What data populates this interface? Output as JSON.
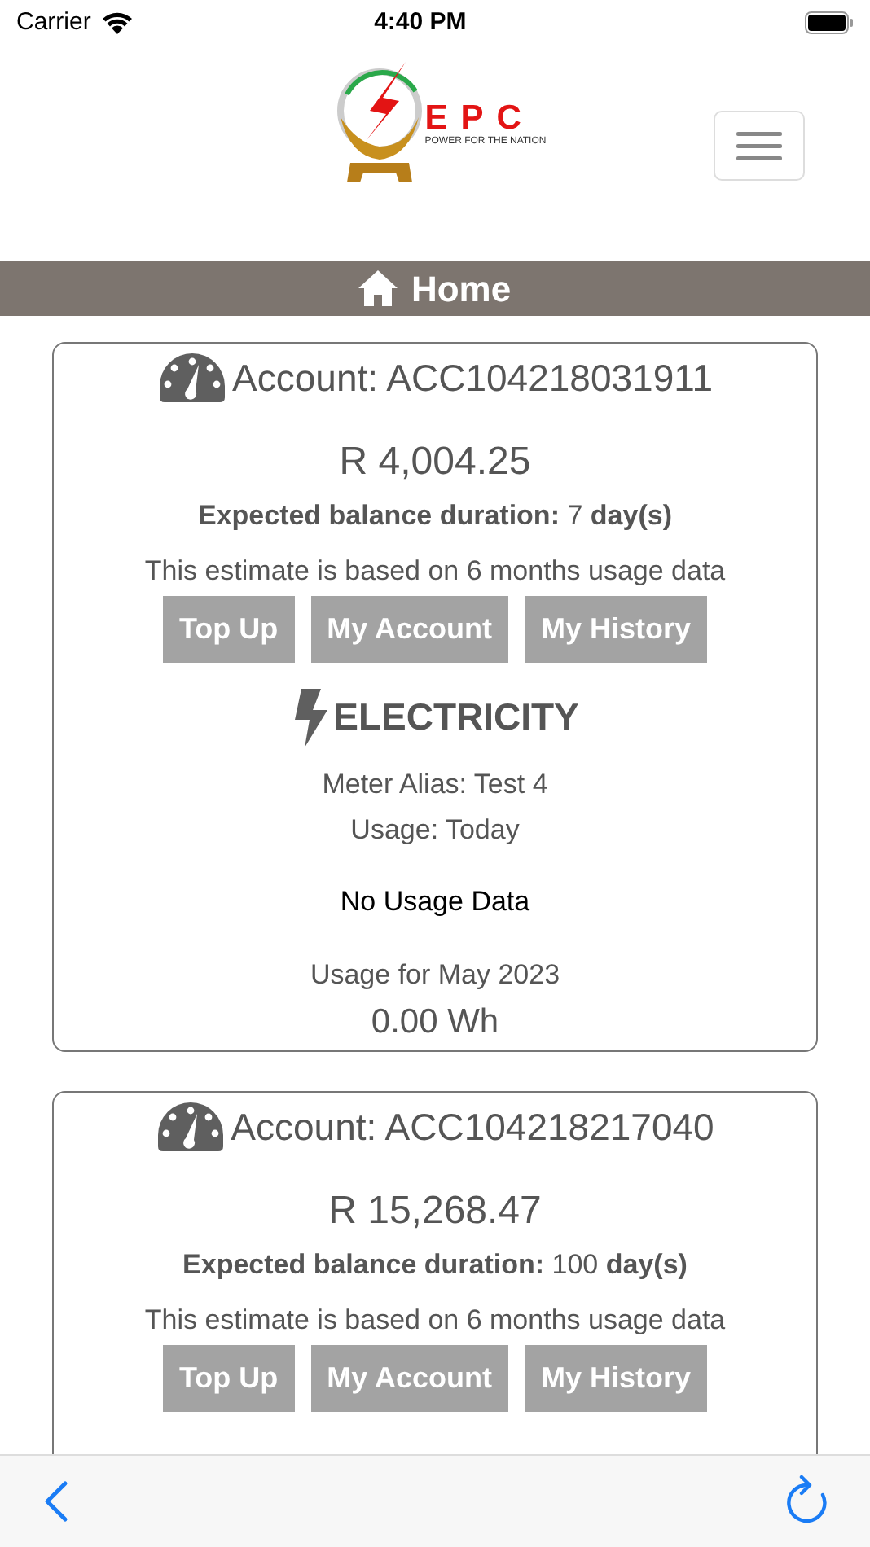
{
  "status_bar": {
    "carrier": "Carrier",
    "time": "4:40 PM"
  },
  "header": {
    "logo_text": "EPC",
    "logo_tagline": "POWER FOR THE NATION"
  },
  "nav_bar": {
    "title": "Home"
  },
  "accounts": [
    {
      "account": "Account: ACC104218031911",
      "balance": "R 4,004.25",
      "duration_label": "Expected balance duration:",
      "duration_value": "7",
      "duration_unit": "day(s)",
      "estimate_note": "This estimate is based on 6 months usage data",
      "buttons": [
        "Top Up",
        "My Account",
        "My History"
      ],
      "utility": "ELECTRICITY",
      "meter_alias": "Meter Alias: Test 4",
      "usage_period": "Usage: Today",
      "usage_status": "No Usage Data",
      "month_label": "Usage for May 2023",
      "month_total": "0.00 Wh"
    },
    {
      "account": "Account: ACC104218217040",
      "balance": "R 15,268.47",
      "duration_label": "Expected balance duration:",
      "duration_value": "100",
      "duration_unit": "day(s)",
      "estimate_note": "This estimate is based on 6 months usage data",
      "buttons": [
        "Top Up",
        "My Account",
        "My History"
      ]
    }
  ]
}
